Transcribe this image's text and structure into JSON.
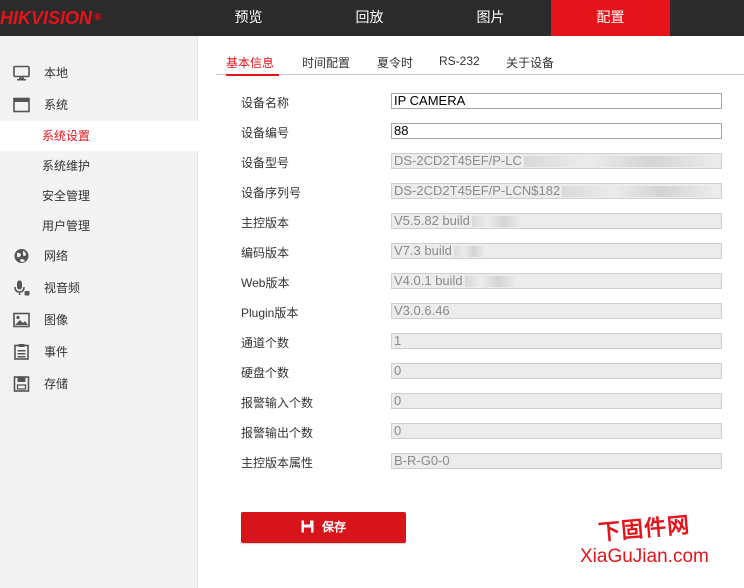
{
  "brand": {
    "logo": "HIKVISION",
    "registered": "®"
  },
  "top_nav": [
    {
      "label": "预览",
      "active": false
    },
    {
      "label": "回放",
      "active": false
    },
    {
      "label": "图片",
      "active": false
    },
    {
      "label": "配置",
      "active": true
    }
  ],
  "sidebar": {
    "items": [
      {
        "label": "本地",
        "icon": "monitor-icon"
      },
      {
        "label": "系统",
        "icon": "system-icon"
      },
      {
        "label": "网络",
        "icon": "globe-icon"
      },
      {
        "label": "视音频",
        "icon": "microphone-icon"
      },
      {
        "label": "图像",
        "icon": "image-icon"
      },
      {
        "label": "事件",
        "icon": "list-icon"
      },
      {
        "label": "存储",
        "icon": "storage-icon"
      }
    ],
    "system_subitems": [
      {
        "label": "系统设置",
        "active": true
      },
      {
        "label": "系统维护",
        "active": false
      },
      {
        "label": "安全管理",
        "active": false
      },
      {
        "label": "用户管理",
        "active": false
      }
    ]
  },
  "tabs": [
    {
      "label": "基本信息",
      "active": true
    },
    {
      "label": "时间配置",
      "active": false
    },
    {
      "label": "夏令时",
      "active": false
    },
    {
      "label": "RS-232",
      "active": false
    },
    {
      "label": "关于设备",
      "active": false
    }
  ],
  "form": [
    {
      "label": "设备名称",
      "value": "IP CAMERA",
      "editable": true
    },
    {
      "label": "设备编号",
      "value": "88",
      "editable": true
    },
    {
      "label": "设备型号",
      "value": "DS-2CD2T45EF/P-LC",
      "editable": false,
      "redacted": true
    },
    {
      "label": "设备序列号",
      "value": "DS-2CD2T45EF/P-LCN$182",
      "editable": false,
      "redacted": true
    },
    {
      "label": "主控版本",
      "value": "V5.5.82 build",
      "editable": false,
      "redacted": true
    },
    {
      "label": "编码版本",
      "value": "V7.3 build",
      "editable": false,
      "redacted": true
    },
    {
      "label": "Web版本",
      "value": "V4.0.1 build",
      "editable": false,
      "redacted": true
    },
    {
      "label": "Plugin版本",
      "value": "V3.0.6.46",
      "editable": false
    },
    {
      "label": "通道个数",
      "value": "1",
      "editable": false
    },
    {
      "label": "硬盘个数",
      "value": "0",
      "editable": false
    },
    {
      "label": "报警输入个数",
      "value": "0",
      "editable": false
    },
    {
      "label": "报警输出个数",
      "value": "0",
      "editable": false
    },
    {
      "label": "主控版本属性",
      "value": "B-R-G0-0",
      "editable": false
    }
  ],
  "save_button": {
    "label": "保存"
  },
  "watermark": {
    "line1": "下固件网",
    "line2": "XiaGuJian.com"
  },
  "colors": {
    "accent": "#e5141b",
    "topbar": "#2b2b2b",
    "sidebar": "#f3f3f3"
  }
}
